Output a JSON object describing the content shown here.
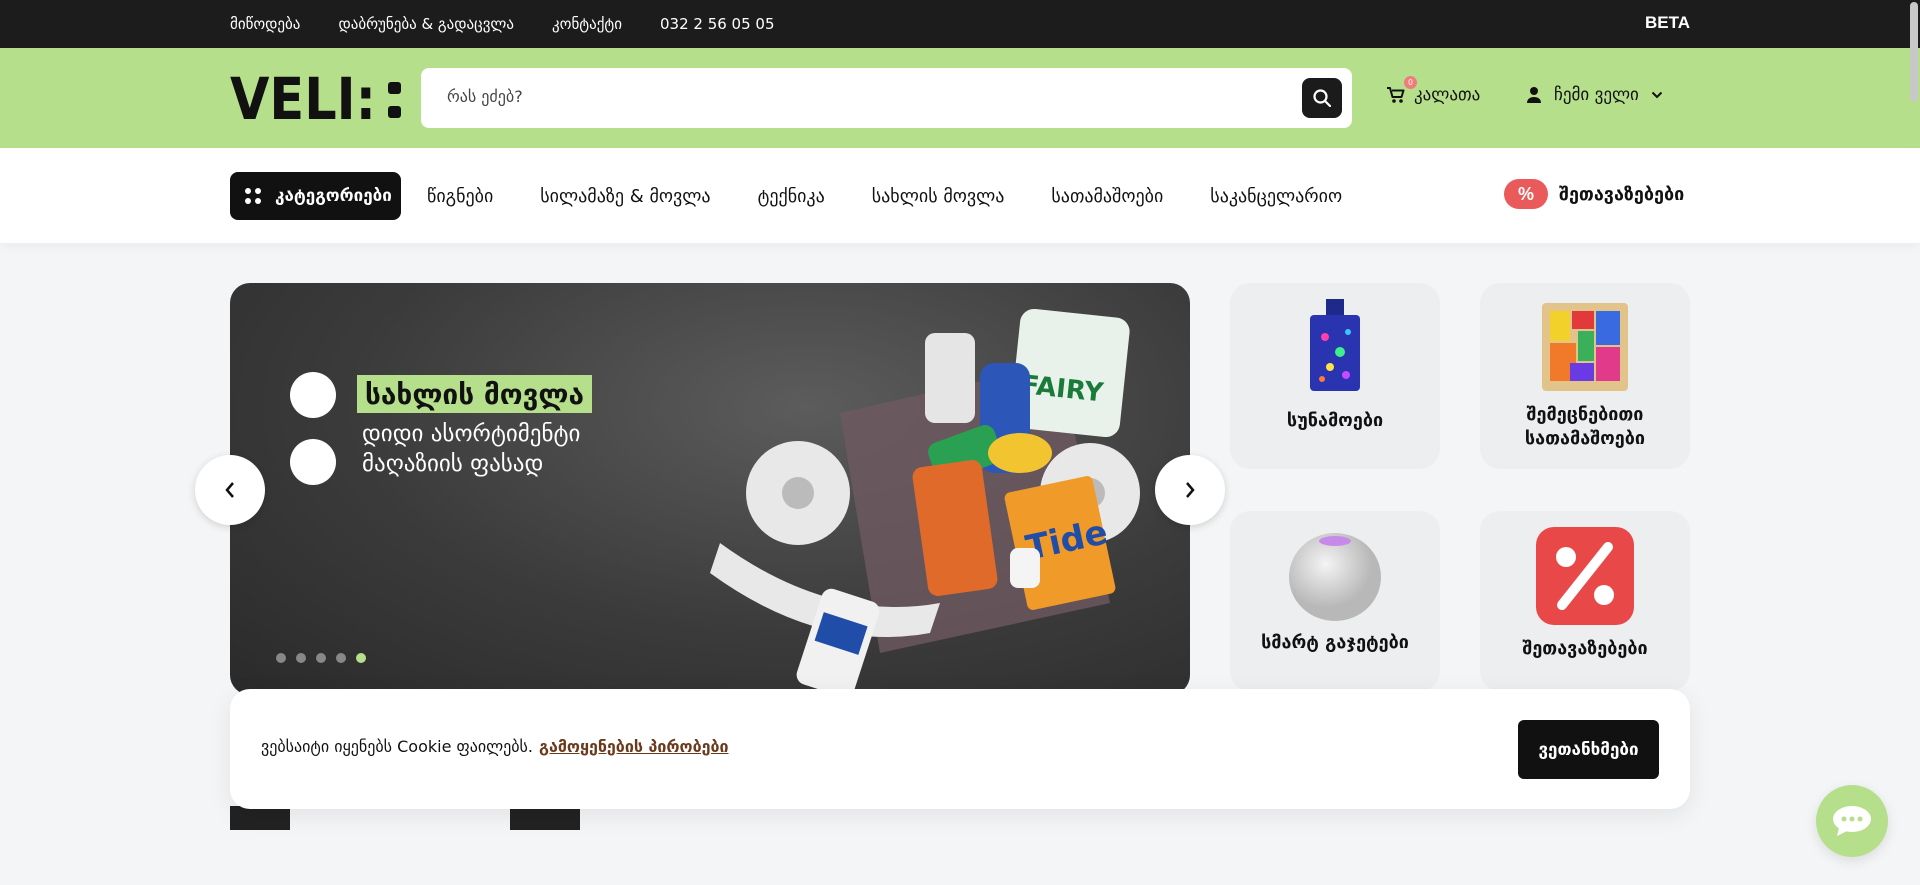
{
  "topbar": {
    "links": [
      "მიწოდება",
      "დაბრუნება & გადაცვლა",
      "კონტაქტი",
      "032 2 56 05 05"
    ],
    "beta": "BETA"
  },
  "header": {
    "logo_text": "VELI:",
    "search_placeholder": "რას ეძებ?",
    "cart_count": "0",
    "cart_label": "კალათა",
    "account_label": "ჩემი ველი"
  },
  "nav": {
    "categories_label": "კატეგორიები",
    "items": [
      "წიგნები",
      "სილამაზე & მოვლა",
      "ტექნიკა",
      "სახლის მოვლა",
      "სათამაშოები",
      "საკანცელარიო"
    ],
    "deals_icon": "%",
    "deals_label": "შეთავაზებები"
  },
  "hero": {
    "title": "სახლის მოვლა",
    "line1": "დიდი ასორტიმენტი",
    "line2": "მაღაზიის ფასად",
    "product_text": "FAIRY",
    "slide_count": 5,
    "active_slide": 5
  },
  "tiles": [
    {
      "label": "სუნამოები",
      "icon": "perfume-icon"
    },
    {
      "label": "შემეცნებითი სათამაშოები",
      "icon": "puzzle-icon"
    },
    {
      "label": "სმარტ გაჯეტები",
      "icon": "smart-speaker-icon"
    },
    {
      "label": "შეთავაზებები",
      "icon": "percent-icon"
    }
  ],
  "cookie": {
    "text": "ვებსაიტი იყენებს Cookie ფაილებს.",
    "link": "გამოყენების პირობები",
    "accept": "ვეთანხმები"
  },
  "colors": {
    "brand_green": "#b6df8c",
    "dark": "#1c1c1c",
    "deal_red": "#ea5a5a"
  }
}
